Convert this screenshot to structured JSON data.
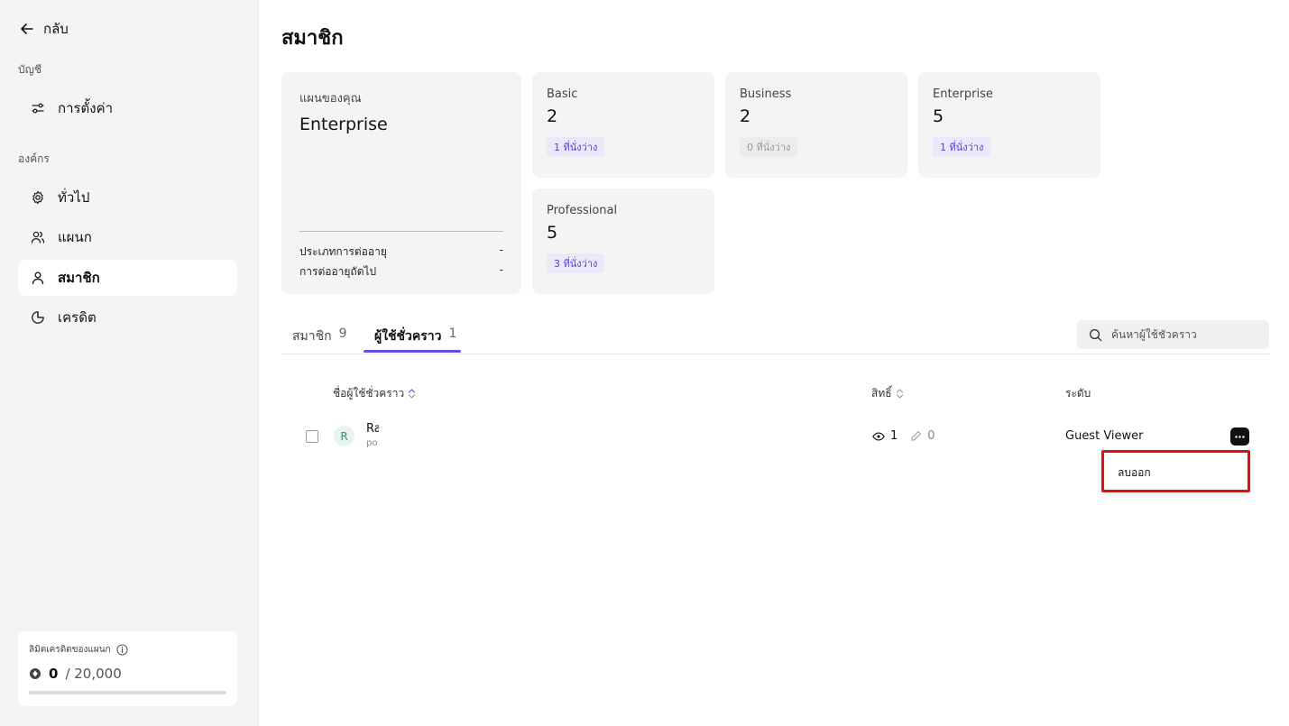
{
  "sidebar": {
    "back_label": "กลับ",
    "account_section": "บัญชี",
    "org_section": "องค์กร",
    "items": [
      {
        "label": "การตั้งค่า",
        "icon": "sliders-icon"
      },
      {
        "label": "ทั่วไป",
        "icon": "gear-icon"
      },
      {
        "label": "แผนก",
        "icon": "users-icon"
      },
      {
        "label": "สมาชิก",
        "icon": "user-icon"
      },
      {
        "label": "เครดิต",
        "icon": "pie-chart-icon"
      }
    ],
    "credit": {
      "title": "ลิมิตเครดิตของแผนก",
      "used": "0",
      "total": "/ 20,000",
      "fraction": 0
    }
  },
  "main": {
    "title": "สมาชิก",
    "plan": {
      "label": "แผนของคุณ",
      "name": "Enterprise",
      "rows": [
        {
          "label": "ประเภทการต่ออายุ",
          "value": "-"
        },
        {
          "label": "การต่ออายุถัดไป",
          "value": "-"
        }
      ]
    },
    "seats": [
      {
        "name": "Basic",
        "count": "2",
        "badge": "1 ที่นั่งว่าง"
      },
      {
        "name": "Business",
        "count": "2",
        "badge": "0 ที่นั่งว่าง"
      },
      {
        "name": "Enterprise",
        "count": "5",
        "badge": "1 ที่นั่งว่าง"
      },
      {
        "name": "Professional",
        "count": "5",
        "badge": "3 ที่นั่งว่าง"
      }
    ],
    "tabs": [
      {
        "label": "สมาชิก",
        "count": "9"
      },
      {
        "label": "ผู้ใช้ชั่วคราว",
        "count": "1"
      }
    ],
    "search_placeholder": "ค้นหาผู้ใช้ชั่วคราว",
    "table": {
      "headers": {
        "name": "ชื่อผู้ใช้ชั่วคราว",
        "permission": "สิทธิ์",
        "level": "ระดับ"
      },
      "rows": [
        {
          "avatar": "R",
          "name": "Ra",
          "email": "po",
          "view_count": "1",
          "edit_count": "0",
          "level": "Guest Viewer"
        }
      ]
    },
    "menu": {
      "remove_label": "ลบออก"
    }
  },
  "colors": {
    "accent": "#6c4ce0",
    "highlight": "#e01010"
  }
}
